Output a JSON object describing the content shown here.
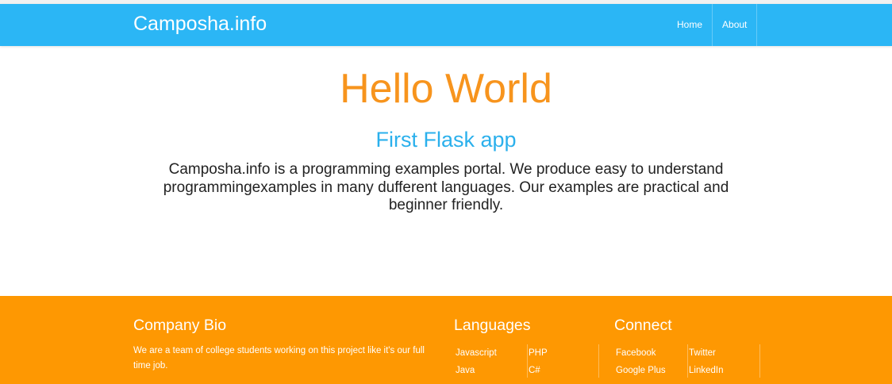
{
  "navbar": {
    "brand": "Camposha.info",
    "links": [
      "Home",
      "About"
    ],
    "color": "#2bb6f5"
  },
  "main": {
    "title": "Hello World",
    "subtitle": "First Flask app",
    "text": "Camposha.info is a programming examples portal. We produce easy to understand programmingexamples in many dufferent languages. Our examples are practical and beginner friendly.",
    "title_color": "#f7941d",
    "subtitle_color": "#2bb0ec"
  },
  "footer": {
    "color": "#fe9802",
    "bio": {
      "title": "Company Bio",
      "text": "We are a team of college students working on this project like it's our full time job."
    },
    "languages": {
      "title": "Languages",
      "col1": [
        "Javascript",
        "Java"
      ],
      "col2": [
        "PHP",
        "C#"
      ]
    },
    "connect": {
      "title": "Connect",
      "col1": [
        "Facebook",
        "Google Plus"
      ],
      "col2": [
        "Twitter",
        "LinkedIn"
      ]
    }
  }
}
